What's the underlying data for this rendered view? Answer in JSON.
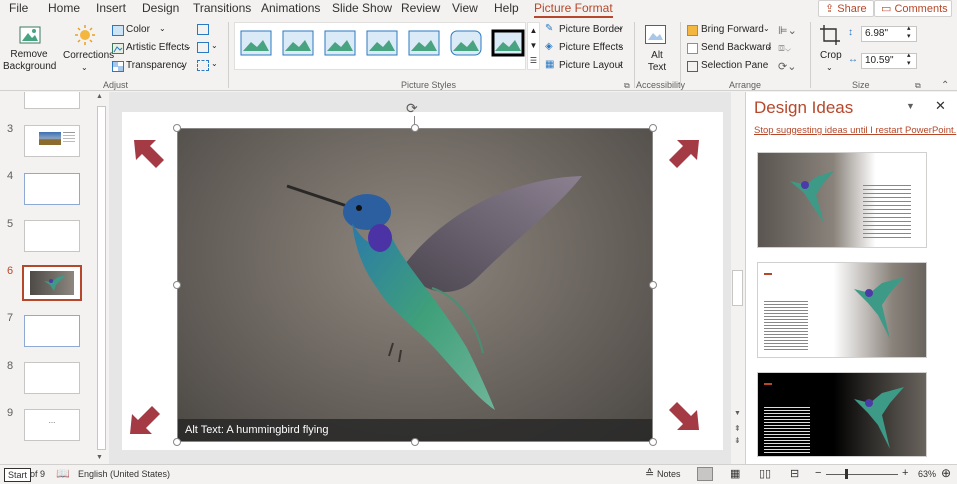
{
  "tabs": [
    "File",
    "Home",
    "Insert",
    "Design",
    "Transitions",
    "Animations",
    "Slide Show",
    "Review",
    "View",
    "Help",
    "Picture Format"
  ],
  "share_label": "Share",
  "comments_label": "Comments",
  "ribbon": {
    "remove_bg": "Remove Background",
    "corrections": "Corrections",
    "color": "Color",
    "artistic": "Artistic Effects",
    "transparency": "Transparency",
    "adjust": "Adjust",
    "picture_styles": "Picture Styles",
    "picture_border": "Picture Border",
    "picture_effects": "Picture Effects",
    "picture_layout": "Picture Layout",
    "alt_text": "Alt Text",
    "accessibility": "Accessibility",
    "bring_forward": "Bring Forward",
    "send_backward": "Send Backward",
    "selection_pane": "Selection Pane",
    "arrange": "Arrange",
    "crop": "Crop",
    "height": "6.98\"",
    "width": "10.59\"",
    "size": "Size"
  },
  "slides": [
    {
      "num": "3"
    },
    {
      "num": "4"
    },
    {
      "num": "5"
    },
    {
      "num": "6"
    },
    {
      "num": "7"
    },
    {
      "num": "8"
    },
    {
      "num": "9"
    }
  ],
  "slide9_text": "...",
  "alt_caption": "Alt Text: A hummingbird flying",
  "design": {
    "title": "Design Ideas",
    "stop_link": "Stop suggesting ideas until I restart PowerPoint."
  },
  "status": {
    "start": "Start",
    "slide_of": "of 9",
    "language": "English (United States)",
    "notes": "Notes",
    "zoom": "63%"
  },
  "colors": {
    "accent": "#b7472a",
    "arrow": "#a33a44"
  }
}
